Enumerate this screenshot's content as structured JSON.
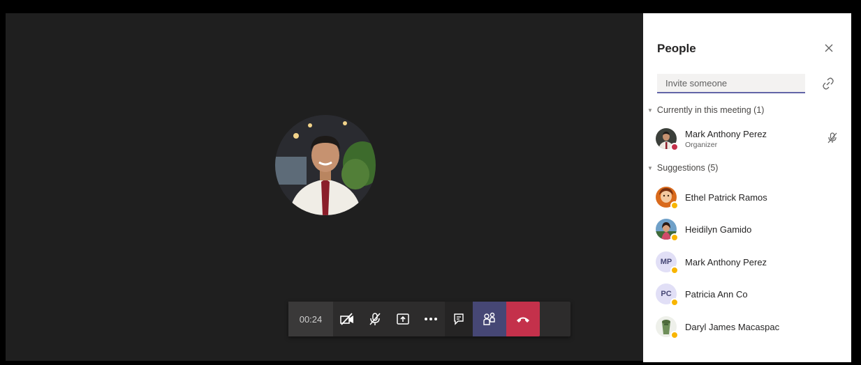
{
  "call": {
    "timer": "00:24",
    "controls": [
      {
        "id": "camera",
        "icon": "camera-off-icon"
      },
      {
        "id": "mic",
        "icon": "mic-off-icon"
      },
      {
        "id": "share",
        "icon": "share-screen-icon"
      },
      {
        "id": "more",
        "icon": "more-actions-icon"
      },
      {
        "id": "chat",
        "icon": "chat-icon"
      },
      {
        "id": "people",
        "icon": "people-icon"
      },
      {
        "id": "leave",
        "icon": "hang-up-icon"
      }
    ],
    "colors": {
      "stage": "#1f1f1f",
      "bar": "#2d2c2c",
      "accent": "#6264a7",
      "people_active": "#464775",
      "leave": "#c4314b"
    }
  },
  "people_panel": {
    "title": "People",
    "invite_placeholder": "Invite someone",
    "current_section": "Currently in this meeting (1)",
    "current": [
      {
        "name": "Mark Anthony Perez",
        "role": "Organizer",
        "status": "busy",
        "muted": true
      }
    ],
    "suggestions_section": "Suggestions (5)",
    "suggestions": [
      {
        "name": "Ethel Patrick Ramos",
        "avatar": "photo",
        "status": "away"
      },
      {
        "name": "Heidilyn Gamido",
        "avatar": "photo",
        "status": "away"
      },
      {
        "name": "Mark Anthony Perez",
        "avatar": "initials",
        "initials": "MP",
        "status": "away"
      },
      {
        "name": "Patricia Ann Co",
        "avatar": "initials",
        "initials": "PC",
        "status": "away"
      },
      {
        "name": "Daryl James Macaspac",
        "avatar": "photo",
        "status": "away"
      }
    ]
  }
}
